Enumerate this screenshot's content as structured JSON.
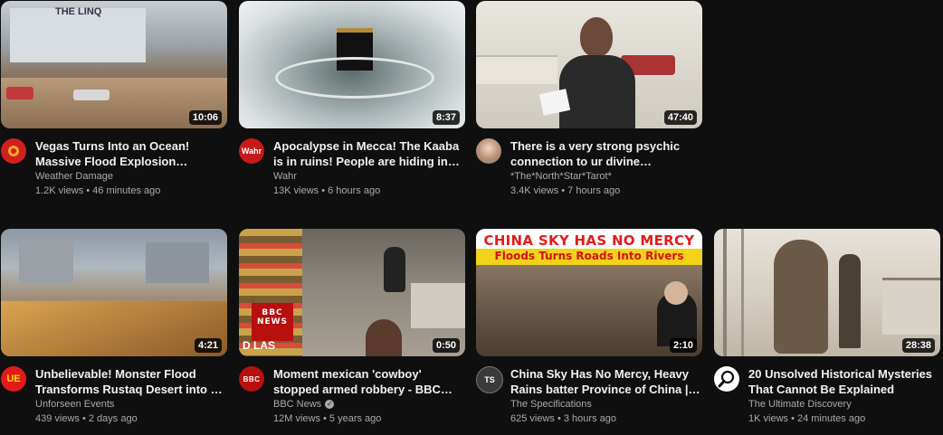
{
  "videos": [
    {
      "title": "Vegas Turns Into an Ocean! Massive Flood Explosion…",
      "channel": "Weather Damage",
      "stats": "1.2K views • 46 minutes ago",
      "duration": "10:06",
      "thumbnail_text": "THE LINQ",
      "icon": "weather-damage-avatar-icon"
    },
    {
      "title": "Apocalypse in Mecca! The Kaaba is in ruins! People are hiding in…",
      "channel": "Wahr",
      "stats": "13K views • 6 hours ago",
      "duration": "8:37",
      "avatar_text": "Wahr",
      "icon": "wahr-avatar-icon"
    },
    {
      "title": "There is a very strong psychic connection to ur divine…",
      "channel": "*The*North*Star*Tarot*",
      "stats": "3.4K views • 7 hours ago",
      "duration": "47:40",
      "icon": "tarot-avatar-icon"
    },
    {
      "title": "Unbelievable! Monster Flood Transforms Rustaq Desert into …",
      "channel": "Unforseen Events",
      "stats": "439 views • 2 days ago",
      "duration": "4:21",
      "avatar_text": "UE",
      "icon": "unforseen-events-avatar-icon"
    },
    {
      "title": "Moment mexican 'cowboy' stopped armed robbery - BBC…",
      "channel": "BBC News",
      "stats": "12M views • 5 years ago",
      "duration": "0:50",
      "avatar_text": "BBC",
      "thumbnail_text": "BBC NEWS",
      "thumbnail_caption": "D   LAS",
      "icon": "bbc-news-avatar-icon"
    },
    {
      "title": "China Sky Has No Mercy, Heavy Rains batter Province of China |…",
      "channel": "The Specifications",
      "stats": "625 views • 3 hours ago",
      "duration": "2:10",
      "avatar_text": "TS",
      "thumbnail_text": "CHINA SKY HAS NO MERCY",
      "thumbnail_subtext": "Floods Turns Roads Into Rivers",
      "icon": "the-specifications-avatar-icon"
    },
    {
      "title": "20 Unsolved Historical Mysteries That Cannot Be Explained",
      "channel": "The Ultimate Discovery",
      "stats": "1K views • 24 minutes ago",
      "duration": "28:38",
      "icon": "magnifier-avatar-icon"
    }
  ],
  "colors": {
    "background": "#0f0f0f",
    "primary_text": "#f1f1f1",
    "secondary_text": "#aaaaaa"
  }
}
